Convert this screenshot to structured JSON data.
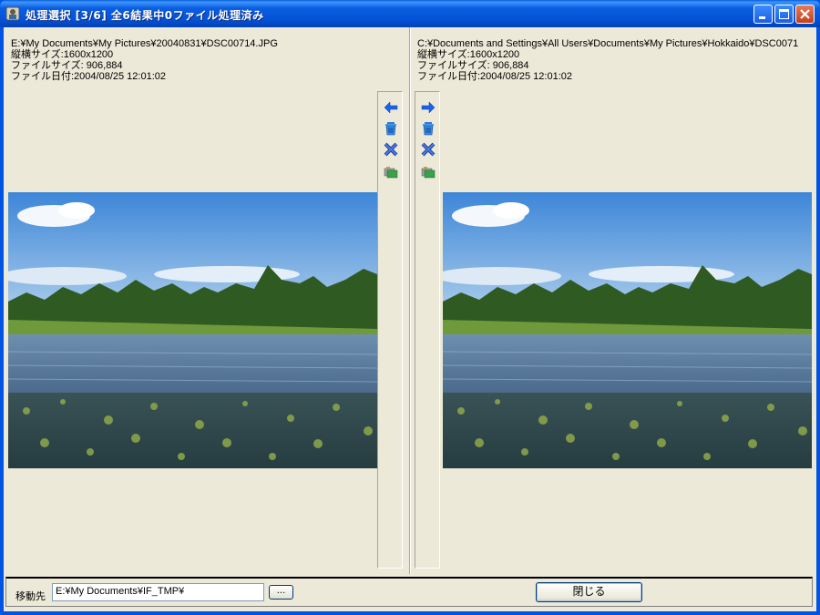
{
  "window": {
    "title": "処理選択 [3/6] 全6結果中0ファイル処理済み",
    "controls": [
      "minimize-icon",
      "maximize-icon",
      "close-icon"
    ]
  },
  "left_file": {
    "path": "E:¥My Documents¥My Pictures¥20040831¥DSC00714.JPG",
    "dimensions": "縦横サイズ:1600x1200",
    "filesize": "ファイルサイズ: 906,884",
    "date": "ファイル日付:2004/08/25 12:01:02"
  },
  "right_file": {
    "path": "C:¥Documents and Settings¥All Users¥Documents¥My Pictures¥Hokkaido¥DSC0071",
    "dimensions": "縦横サイズ:1600x1200",
    "filesize": "ファイルサイズ: 906,884",
    "date": "ファイル日付:2004/08/25 12:01:02"
  },
  "tools": {
    "left": [
      "arrow-left-icon",
      "trash-icon",
      "delete-x-icon",
      "move-folder-icon"
    ],
    "right": [
      "arrow-right-icon",
      "trash-icon",
      "delete-x-icon",
      "move-folder-icon"
    ]
  },
  "bottom": {
    "dest_label": "移動先",
    "dest_value": "E:¥My Documents¥IF_TMP¥",
    "browse_label": "...",
    "close_label": "閉じる"
  },
  "colors": {
    "titlebar": "#0a5ee0",
    "dialog_bg": "#ece9d8",
    "arrow_blue": "#1a64e8"
  }
}
